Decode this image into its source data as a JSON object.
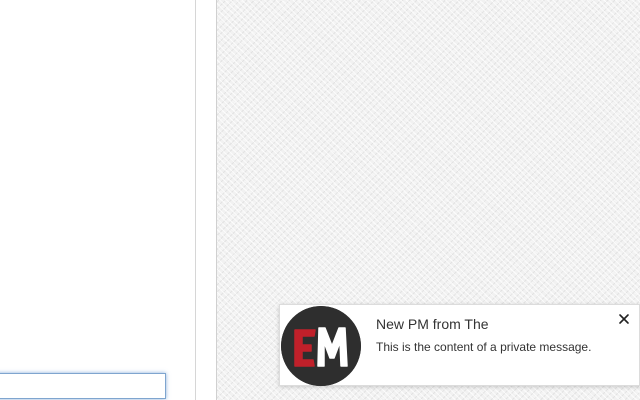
{
  "composer": {
    "input_value": "",
    "input_placeholder": ""
  },
  "notification": {
    "title": "New PM from The",
    "body": "This is the content of a private message.",
    "icon": "em-logo-icon",
    "close_icon": "close-icon",
    "logo_letters": "EM",
    "colors": {
      "logo_background": "#2e2e2e",
      "logo_letter_e": "#c0202a",
      "logo_letter_m": "#ffffff"
    }
  }
}
